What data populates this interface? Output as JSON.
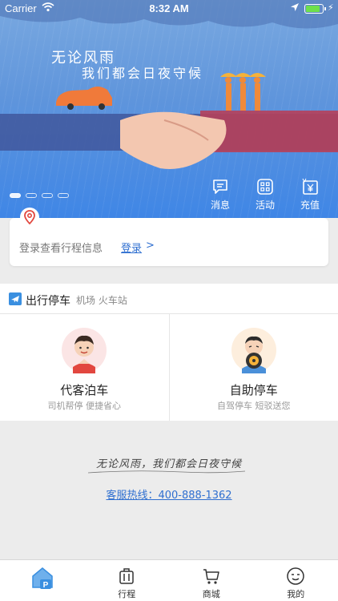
{
  "status_bar": {
    "carrier": "Carrier",
    "time": "8:32 AM"
  },
  "banner": {
    "slogan_line1": "无论风雨",
    "slogan_line2": "我们都会日夜守候",
    "dots_count": 4,
    "active_dot": 0
  },
  "quick_actions": [
    {
      "label": "消息",
      "icon": "message-icon"
    },
    {
      "label": "活动",
      "icon": "activity-grid-icon"
    },
    {
      "label": "充值",
      "icon": "recharge-yen-icon"
    }
  ],
  "login_card": {
    "prompt": "登录查看行程信息",
    "link": "登录",
    "arrow": ">"
  },
  "section": {
    "title": "出行停车",
    "subtitle": "机场 火车站"
  },
  "services": [
    {
      "name": "代客泊车",
      "desc": "司机帮停 便捷省心",
      "icon": "valet-driver-avatar"
    },
    {
      "name": "自助停车",
      "desc": "自驾停车 短驳送您",
      "icon": "self-park-driver-avatar"
    }
  ],
  "footer": {
    "slogan": "无论风雨，我们都会日夜守候",
    "hotline": "客服热线：400-888-1362"
  },
  "tabbar": [
    {
      "label": "",
      "icon": "home-parking-icon",
      "active": true
    },
    {
      "label": "行程",
      "icon": "luggage-icon"
    },
    {
      "label": "商城",
      "icon": "cart-icon"
    },
    {
      "label": "我的",
      "icon": "face-icon"
    }
  ],
  "colors": {
    "accent": "#2f6fd0",
    "banner_top": "#7aa9e0",
    "banner_bottom": "#3f86e6",
    "background": "#ececec"
  }
}
